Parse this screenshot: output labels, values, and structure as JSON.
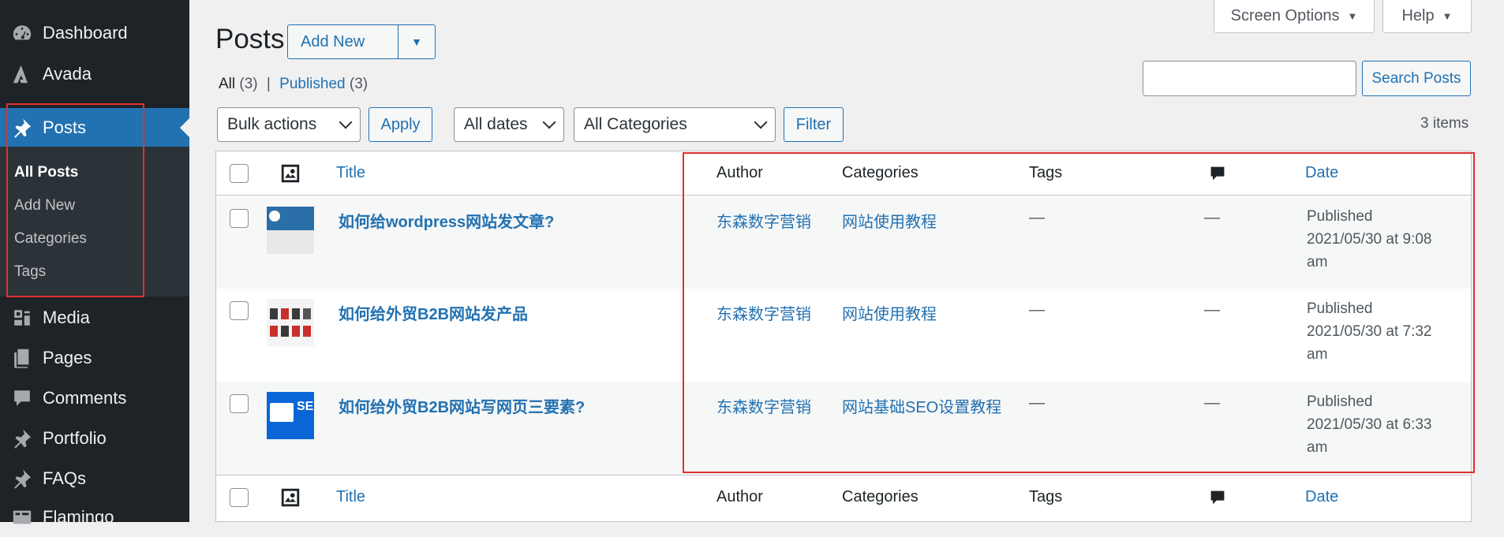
{
  "sidebar": {
    "items": [
      {
        "label": "Dashboard",
        "icon": "dashboard-icon"
      },
      {
        "label": "Avada",
        "icon": "avada-icon"
      },
      {
        "label": "Posts",
        "icon": "pin-icon"
      },
      {
        "label": "Media",
        "icon": "media-icon"
      },
      {
        "label": "Pages",
        "icon": "pages-icon"
      },
      {
        "label": "Comments",
        "icon": "comments-icon"
      },
      {
        "label": "Portfolio",
        "icon": "pin-icon"
      },
      {
        "label": "FAQs",
        "icon": "pin-icon"
      },
      {
        "label": "Flamingo",
        "icon": "flamingo-icon"
      }
    ],
    "submenu": [
      "All Posts",
      "Add New",
      "Categories",
      "Tags"
    ]
  },
  "top_buttons": {
    "screen_options": "Screen Options",
    "help": "Help"
  },
  "heading": {
    "title": "Posts",
    "add_new": "Add New"
  },
  "views": {
    "all": "All",
    "all_count": "(3)",
    "separator": "|",
    "published": "Published",
    "published_count": "(3)"
  },
  "search": {
    "value": "",
    "button": "Search Posts"
  },
  "filters": {
    "bulk_actions": "Bulk actions",
    "apply": "Apply",
    "dates": "All dates",
    "categories": "All Categories",
    "filter": "Filter"
  },
  "items_count": "3 items",
  "table": {
    "columns": {
      "title": "Title",
      "author": "Author",
      "categories": "Categories",
      "tags": "Tags",
      "date": "Date"
    },
    "rows": [
      {
        "title": "如何给wordpress网站发文章?",
        "author": "东森数字营销",
        "category": "网站使用教程",
        "tags": "—",
        "comments": "—",
        "date_status": "Published",
        "date": "2021/05/30 at 9:08",
        "date_ampm": "am"
      },
      {
        "title": "如何给外贸B2B网站发产品",
        "author": "东森数字营销",
        "category": "网站使用教程",
        "tags": "—",
        "comments": "—",
        "date_status": "Published",
        "date": "2021/05/30 at 7:32",
        "date_ampm": "am"
      },
      {
        "title": "如何给外贸B2B网站写网页三要素?",
        "author": "东森数字营销",
        "category": "网站基础SEO设置教程",
        "tags": "—",
        "comments": "—",
        "date_status": "Published",
        "date": "2021/05/30 at 6:33",
        "date_ampm": "am"
      }
    ]
  },
  "colors": {
    "accent": "#2271b1",
    "sidebar": "#1d2327",
    "highlight_box": "#e03030"
  }
}
